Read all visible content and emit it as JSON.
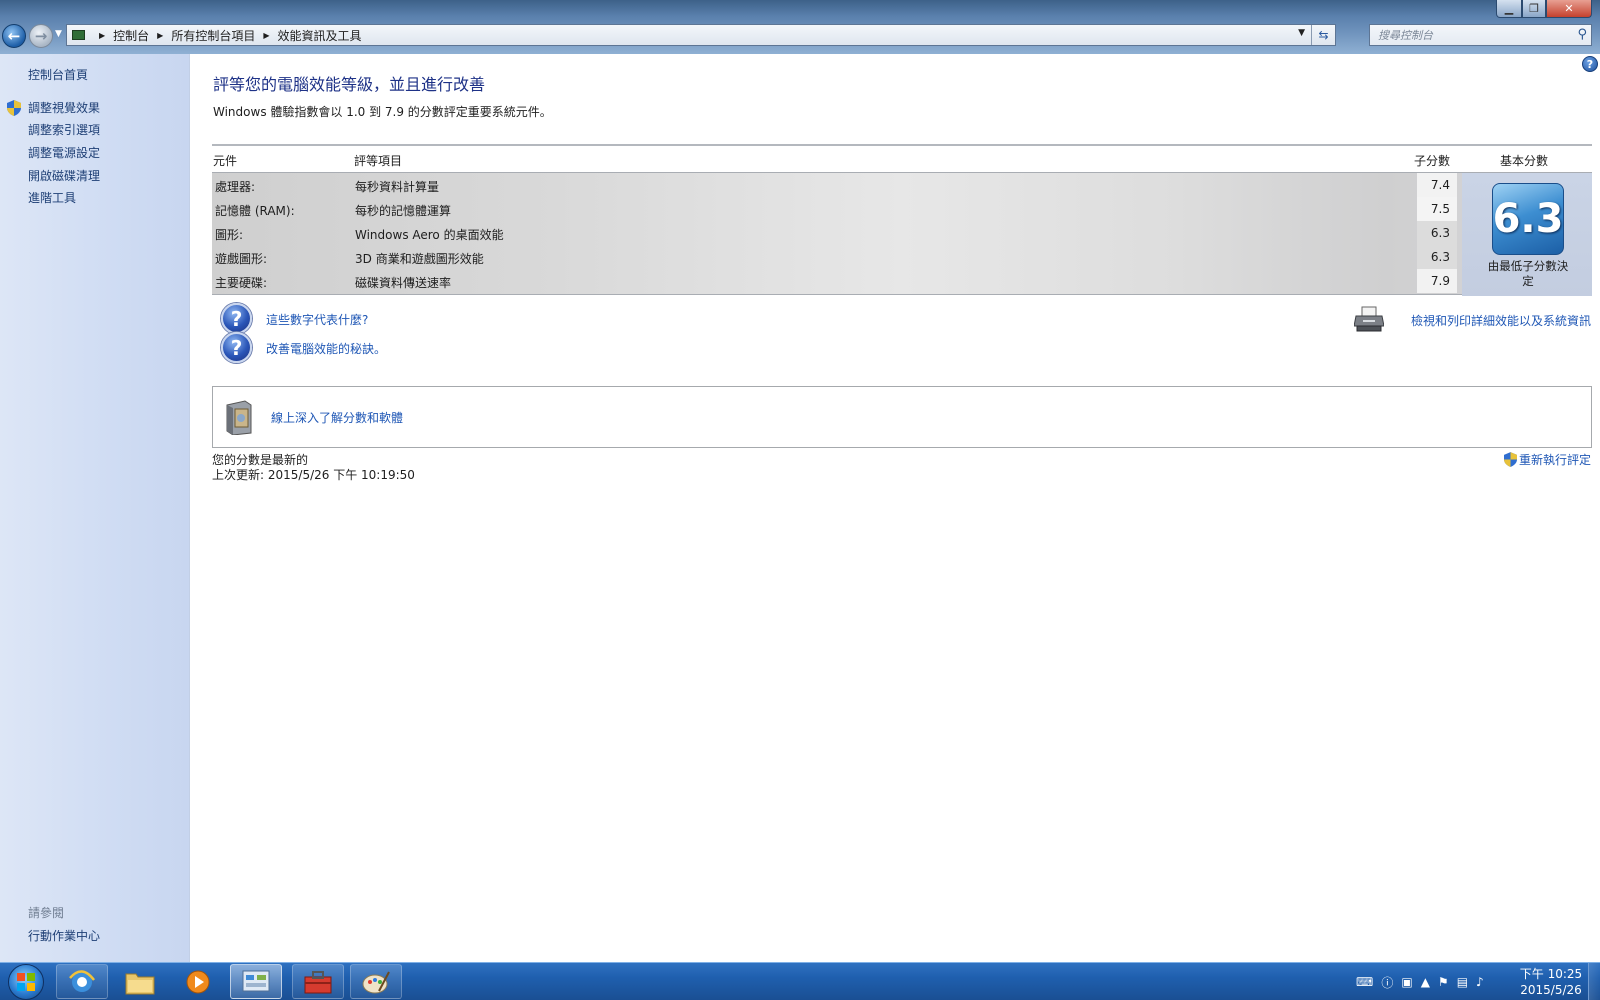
{
  "address_bar": {
    "crumbs": [
      "控制台",
      "所有控制台項目",
      "效能資訊及工具"
    ],
    "search_placeholder": "搜尋控制台"
  },
  "sidebar": {
    "home": "控制台首頁",
    "items": [
      {
        "label": "調整視覺效果",
        "shield": true
      },
      {
        "label": "調整索引選項",
        "shield": false
      },
      {
        "label": "調整電源設定",
        "shield": false
      },
      {
        "label": "開啟磁碟清理",
        "shield": false
      },
      {
        "label": "進階工具",
        "shield": false
      }
    ],
    "see_also_title": "請參閱",
    "see_also_items": [
      "行動作業中心"
    ]
  },
  "main": {
    "title": "評等您的電腦效能等級，並且進行改善",
    "subtitle": "Windows 體驗指數會以 1.0 到 7.9 的分數評定重要系統元件。",
    "table": {
      "headers": {
        "component": "元件",
        "rating": "評等項目",
        "subscore": "子分數",
        "basescore": "基本分數"
      },
      "rows": [
        {
          "component": "處理器:",
          "rating": "每秒資料計算量",
          "subscore": "7.4"
        },
        {
          "component": "記憶體 (RAM):",
          "rating": "每秒的記憶體運算",
          "subscore": "7.5"
        },
        {
          "component": "圖形:",
          "rating": "Windows Aero 的桌面效能",
          "subscore": "6.3"
        },
        {
          "component": "遊戲圖形:",
          "rating": "3D 商業和遊戲圖形效能",
          "subscore": "6.3"
        },
        {
          "component": "主要硬碟:",
          "rating": "磁碟資料傳送速率",
          "subscore": "7.9"
        }
      ],
      "base_score": "6.3",
      "base_score_caption": "由最低子分數決定"
    },
    "links": {
      "what_numbers_mean": "這些數字代表什麼?",
      "tips": "改善電腦效能的秘訣。",
      "print_details": "檢視和列印詳細效能以及系統資訊",
      "learn_online": "線上深入了解分數和軟體"
    },
    "status": "您的分數是最新的",
    "last_update": "上次更新: 2015/5/26 下午 10:19:50",
    "rerun": "重新執行評定"
  },
  "taskbar": {
    "apps": [
      "internet-explorer-icon",
      "explorer-icon",
      "media-player-icon",
      "control-panel-icon",
      "toolbox-icon",
      "paint-icon"
    ],
    "clock_time": "下午 10:25",
    "clock_date": "2015/5/26"
  },
  "colors": {
    "title_blue": "#1e3287",
    "link_blue": "#1f57b5",
    "taskbar_blue": "#1f5fae",
    "score_badge": "#3d8ed1"
  }
}
